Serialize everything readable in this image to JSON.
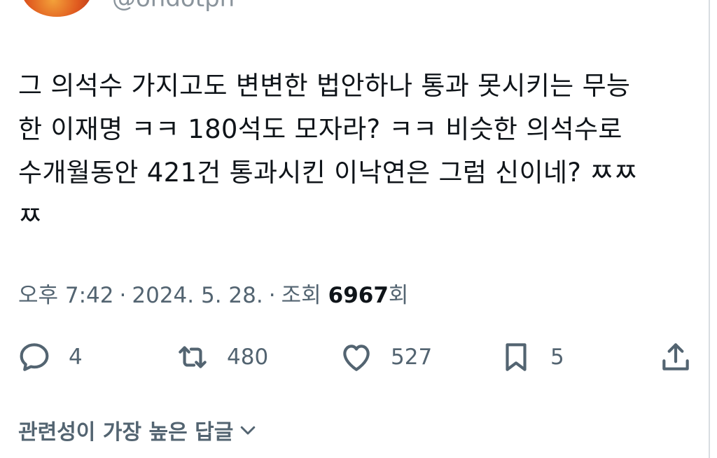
{
  "author": {
    "handle": "@ohdotph"
  },
  "tweet": {
    "lines": [
      "그 의석수 가지고도 변변한 법안하나 통과 못시키는 무능",
      "한 이재명 ㅋㅋ 180석도 모자라? ㅋㅋ 비슷한 의석수로",
      "수개월동안 421건 통과시킨 이낙연은 그럼 신이네? ㅉㅉ",
      "ㅉ"
    ]
  },
  "meta": {
    "time": "오후 7:42",
    "separator": "·",
    "date": "2024. 5. 28.",
    "views_label_prefix": "조회",
    "views_count": "6967",
    "views_label_suffix": "회"
  },
  "actions": {
    "reply": {
      "icon": "reply-icon",
      "count": "4"
    },
    "retweet": {
      "icon": "retweet-icon",
      "count": "480"
    },
    "like": {
      "icon": "heart-icon",
      "count": "527"
    },
    "bookmark": {
      "icon": "bookmark-icon",
      "count": "5"
    },
    "share": {
      "icon": "share-icon"
    }
  },
  "replies": {
    "sort_label": "관련성이 가장 높은 답글"
  },
  "colors": {
    "text": "#0f1419",
    "secondary": "#536471"
  }
}
